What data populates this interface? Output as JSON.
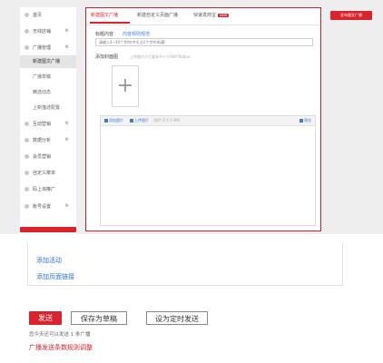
{
  "sidebar": {
    "items": [
      {
        "label": "首页"
      },
      {
        "label": "无线店铺",
        "gear": "⚙"
      },
      {
        "label": "广播管理",
        "gear": "⚙"
      },
      {
        "label": "新建图文广播"
      },
      {
        "label": "广播草稿"
      },
      {
        "label": "精选动态"
      },
      {
        "label": "上新描述配置"
      },
      {
        "label": "互动营销",
        "gear": "⚙"
      },
      {
        "label": "数据分析",
        "gear": "⚙"
      },
      {
        "label": "会员营销"
      },
      {
        "label": "自定义菜单"
      },
      {
        "label": "码上淘推广"
      },
      {
        "label": "账号设置",
        "gear": "⚙"
      }
    ]
  },
  "tabs": [
    {
      "label": "新建图文广播"
    },
    {
      "label": "新建自定义页面广播"
    },
    {
      "label": "快速发商宝",
      "badge": "NEW"
    }
  ],
  "form": {
    "title_label": "标题内容",
    "title_link": "内容规则规范",
    "title_placeholder": "请输入4~30个字符(中文占2个字符)标题",
    "cover_label": "添加封面图",
    "cover_hint": "上传图片尺寸要求不小于600*600px",
    "cover_plus": "+"
  },
  "editor": {
    "add_image": "添加图片",
    "upload_image": "上传图片",
    "upload_hint": "(图片不大于3M)",
    "preview": "预览"
  },
  "publish_button": "发布图文广播",
  "lower": {
    "add_activity": "添加活动",
    "add_page_link": "添加页面链接"
  },
  "actions": {
    "send": "发送",
    "save_draft": "保存为草稿",
    "schedule": "设为定时发送"
  },
  "quota_text": "您今天还可以发送 1 条广播",
  "rules_link": "广播发送条数规则调整",
  "colors": {
    "accent": "#d9242d",
    "link": "#2e6fcf",
    "panel_bg": "#eeeeee"
  }
}
